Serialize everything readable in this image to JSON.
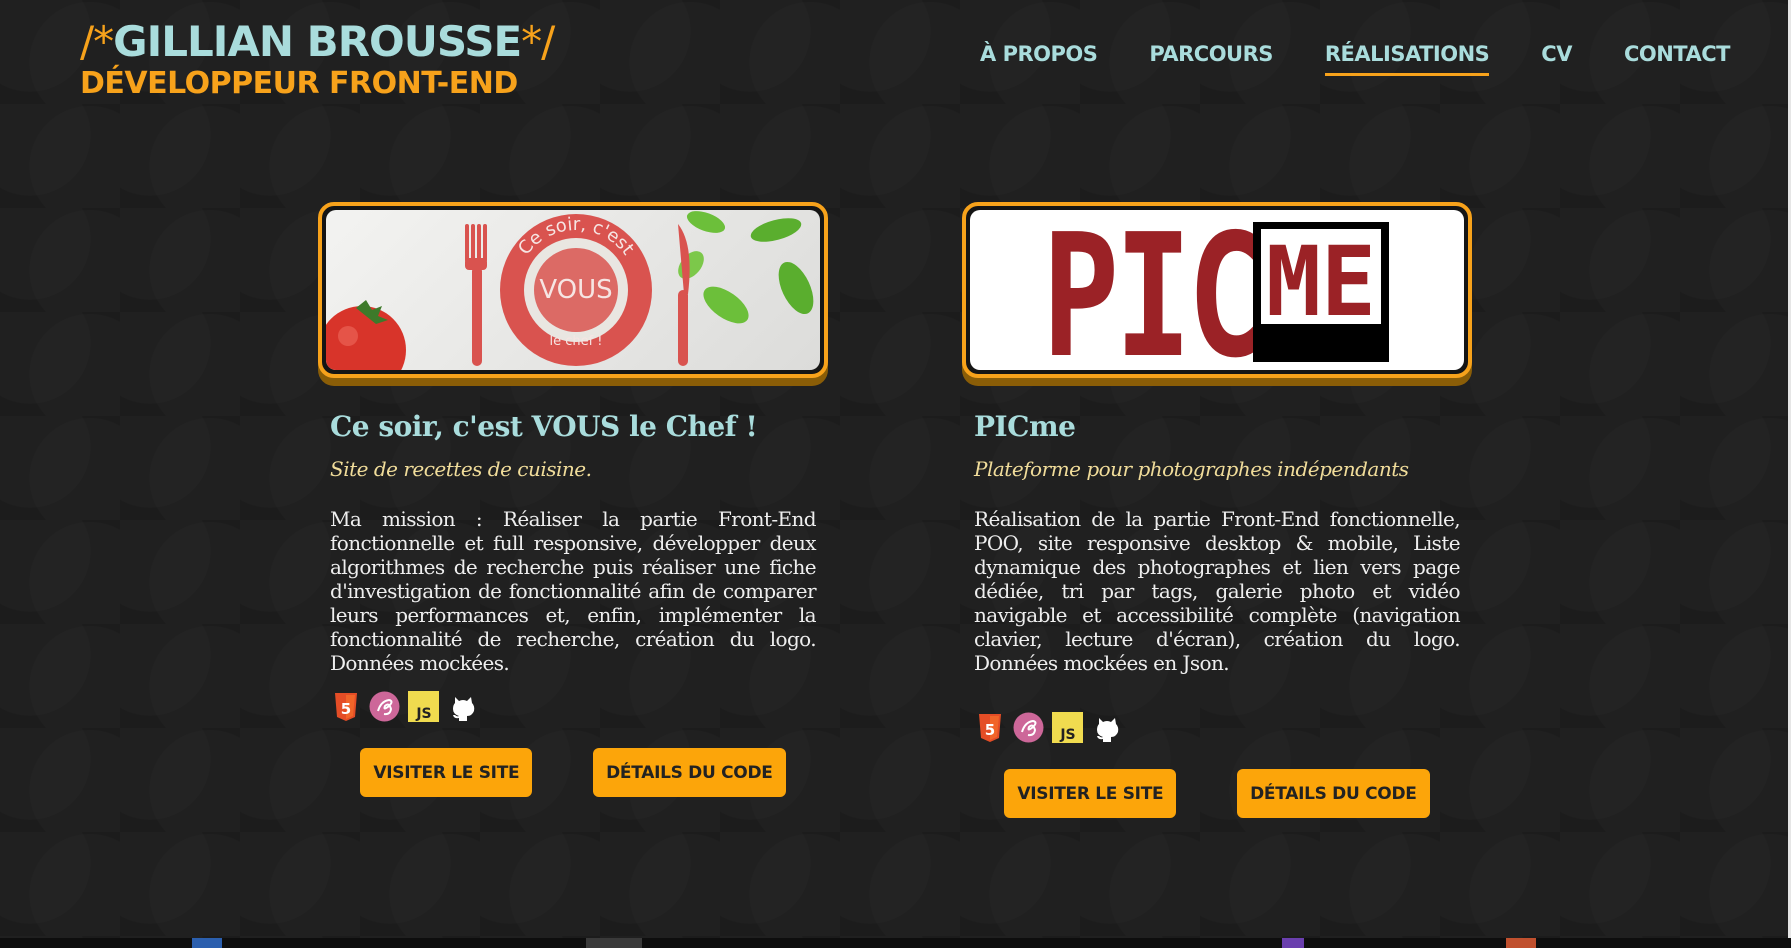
{
  "header": {
    "logo": {
      "slash_open": "/*",
      "name": "GILLIAN BROUSSE",
      "slash_close": "*/",
      "role": "DÉVELOPPEUR FRONT-END"
    },
    "nav": [
      {
        "label": "À PROPOS",
        "active": false
      },
      {
        "label": "PARCOURS",
        "active": false
      },
      {
        "label": "RÉALISATIONS",
        "active": true
      },
      {
        "label": "CV",
        "active": false
      },
      {
        "label": "CONTACT",
        "active": false
      }
    ]
  },
  "projects": [
    {
      "image_text": {
        "top": "Ce soir, c'est",
        "middle": "VOUS",
        "bottom": "le chef !"
      },
      "title": "Ce soir, c'est VOUS le Chef !",
      "subtitle": "Site de recettes de cuisine.",
      "description": "Ma mission : Réaliser la partie Front-End fonctionnelle et full responsive, développer deux algorithmes de recherche puis réaliser une fiche d'investigation de fonctionnalité afin de comparer leurs performances et, enfin, implémenter la fonctionnalité de recherche, création du logo. Données mockées.",
      "tech_icons": [
        "html5-icon",
        "sass-icon",
        "javascript-icon",
        "github-icon"
      ],
      "visit_label": "VISITER LE SITE",
      "code_label": "DÉTAILS DU CODE"
    },
    {
      "image_text": {
        "main": "PIC",
        "badge": "ME"
      },
      "title": "PICme",
      "subtitle": "Plateforme pour photographes indépendants",
      "description": "Réalisation de la partie Front-End fonctionnelle, POO, site responsive desktop & mobile, Liste dynamique des photographes et lien vers page dédiée, tri par tags, galerie photo et vidéo navigable et accessibilité complète (navigation clavier, lecture d'écran), création du logo. Données mockées en Json.",
      "tech_icons": [
        "html5-icon",
        "sass-icon",
        "javascript-icon",
        "github-icon"
      ],
      "visit_label": "VISITER LE SITE",
      "code_label": "DÉTAILS DU CODE"
    }
  ],
  "icons": {
    "html5": "5",
    "javascript": "JS"
  },
  "colors": {
    "background": "#1c1c1c",
    "accent": "#f7a21b",
    "teal": "#a9dcdc",
    "subtitle": "#f0dc9a",
    "button": "#fca50a"
  }
}
